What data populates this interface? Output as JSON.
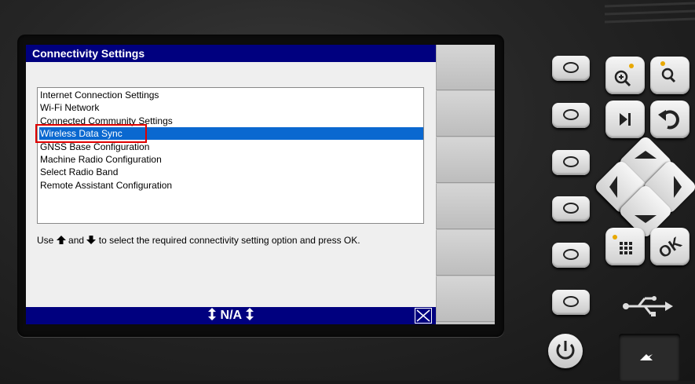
{
  "window": {
    "title": "Connectivity Settings"
  },
  "menu": {
    "items": [
      {
        "label": "Internet Connection Settings",
        "selected": false
      },
      {
        "label": "Wi-Fi Network",
        "selected": false
      },
      {
        "label": "Connected Community Settings",
        "selected": false
      },
      {
        "label": "Wireless Data Sync",
        "selected": true
      },
      {
        "label": "GNSS Base Configuration",
        "selected": false
      },
      {
        "label": "Machine Radio Configuration",
        "selected": false
      },
      {
        "label": "Select Radio Band",
        "selected": false
      },
      {
        "label": "Remote Assistant Configuration",
        "selected": false
      }
    ]
  },
  "instruction": {
    "prefix": "Use",
    "up_icon": "up-arrow-icon",
    "conjunction": "and",
    "down_icon": "down-arrow-icon",
    "suffix": "to select the required connectivity setting option and press OK."
  },
  "statusbar": {
    "value": "N/A"
  },
  "colors": {
    "titlebar": "#00007f",
    "selection": "#0a68d0",
    "highlight_box": "#e00000"
  },
  "hardware": {
    "ok_label": "OK"
  }
}
